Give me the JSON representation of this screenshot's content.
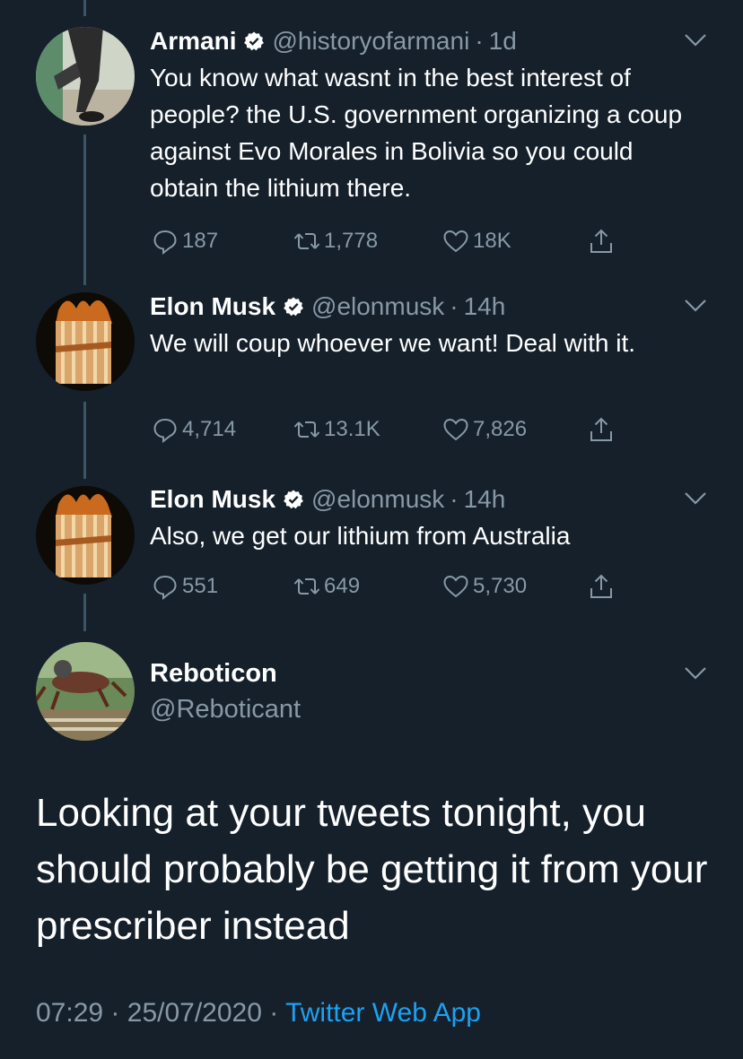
{
  "colors": {
    "background": "#15202b",
    "text": "#ffffff",
    "secondary": "#8899a6",
    "accent": "#1da1f2",
    "thread_line": "#3d5466"
  },
  "tweets": [
    {
      "name": "Armani",
      "verified": true,
      "handle": "@historyofarmani",
      "time": "1d",
      "text": "You know what wasnt in the best interest of people? the U.S. government organizing a coup against Evo Morales in Bolivia so you could obtain the lithium there.",
      "replies": "187",
      "retweets": "1,778",
      "likes": "18K",
      "avatar_icon": "person-photo-avatar"
    },
    {
      "name": "Elon Musk",
      "verified": true,
      "handle": "@elonmusk",
      "time": "14h",
      "text": "We will coup whoever we want! Deal with it.",
      "replies": "4,714",
      "retweets": "13.1K",
      "likes": "7,826",
      "avatar_icon": "burning-flamethrower-avatar"
    },
    {
      "name": "Elon Musk",
      "verified": true,
      "handle": "@elonmusk",
      "time": "14h",
      "text": "Also, we get our lithium from Australia",
      "replies": "551",
      "retweets": "649",
      "likes": "5,730",
      "avatar_icon": "burning-flamethrower-avatar"
    }
  ],
  "main_tweet": {
    "name": "Reboticon",
    "handle": "@Reboticant",
    "text": "Looking at your tweets tonight, you should probably be getting it from your prescriber instead",
    "time": "07:29",
    "date": "25/07/2020",
    "source": "Twitter Web App",
    "separator": "·",
    "avatar_icon": "robot-insect-sculpture-avatar"
  }
}
